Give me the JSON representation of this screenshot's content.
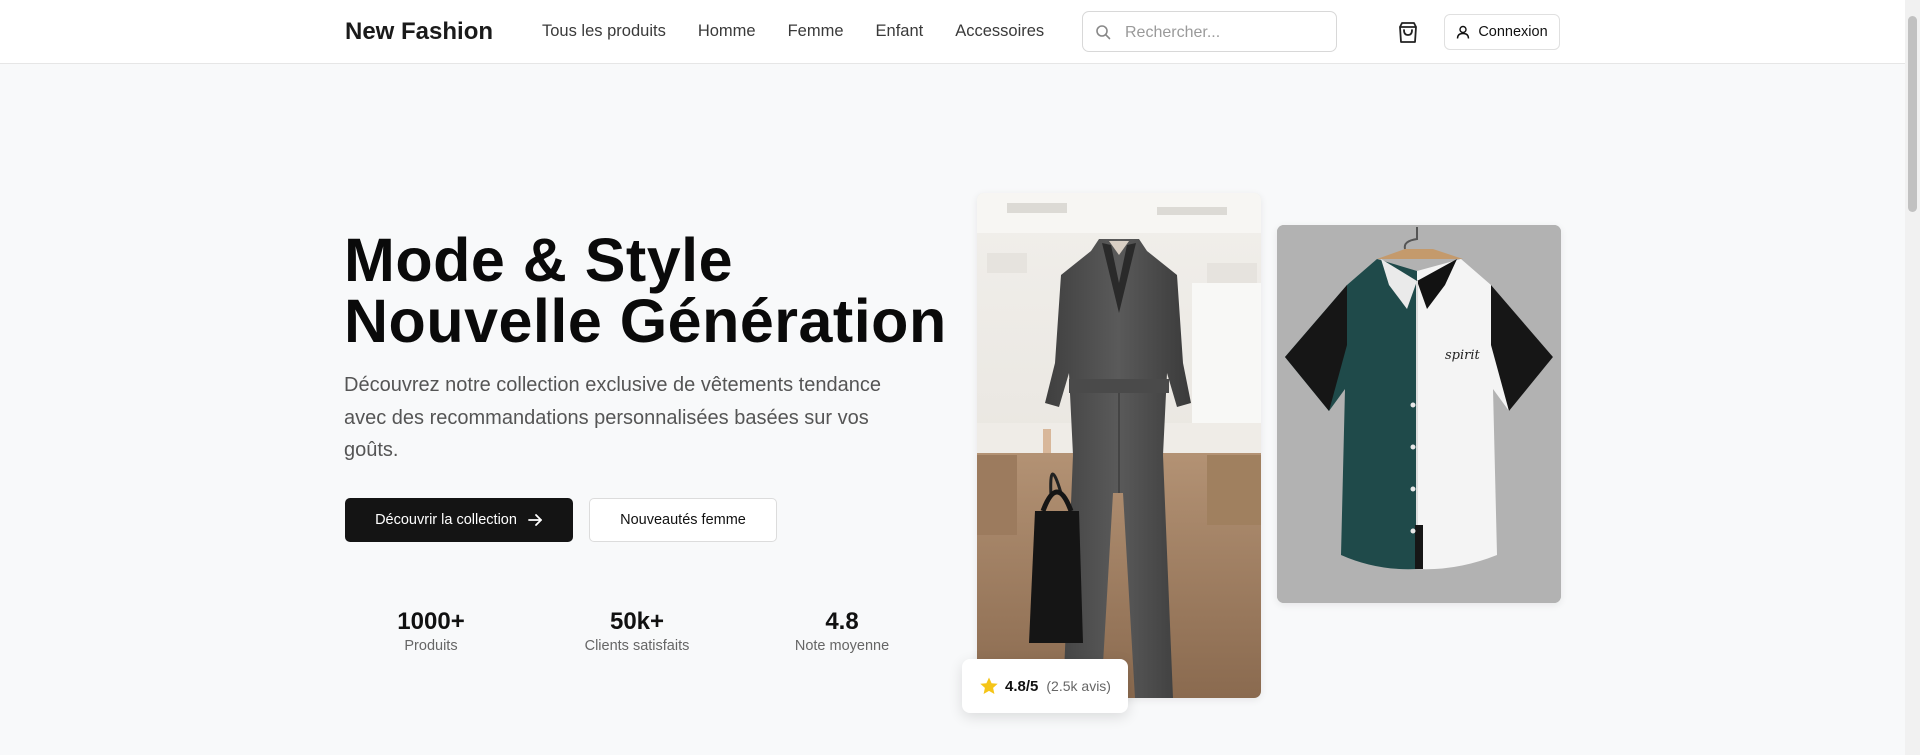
{
  "header": {
    "logo": "New Fashion",
    "nav": [
      "Tous les produits",
      "Homme",
      "Femme",
      "Enfant",
      "Accessoires"
    ],
    "search_placeholder": "Rechercher...",
    "login_label": "Connexion"
  },
  "hero": {
    "title_line1": "Mode & Style",
    "title_line2": "Nouvelle Génération",
    "description": "Découvrez notre collection exclusive de vêtements tendance avec des recommandations personnalisées basées sur vos goûts.",
    "primary_button": "Découvrir la collection",
    "secondary_button": "Nouveautés femme"
  },
  "stats": [
    {
      "value": "1000+",
      "label": "Produits"
    },
    {
      "value": "50k+",
      "label": "Clients satisfaits"
    },
    {
      "value": "4.8",
      "label": "Note moyenne"
    }
  ],
  "rating": {
    "score": "4.8/5",
    "reviews": "(2.5k avis)",
    "star_color": "#f5c518"
  },
  "images": [
    {
      "alt": "jumpsuit-photo"
    },
    {
      "alt": "shirt-photo",
      "shirt_text": "spirit"
    }
  ],
  "colors": {
    "primary": "#141414",
    "background": "#f8f9fa",
    "shirt_green": "#1f4a4a"
  }
}
